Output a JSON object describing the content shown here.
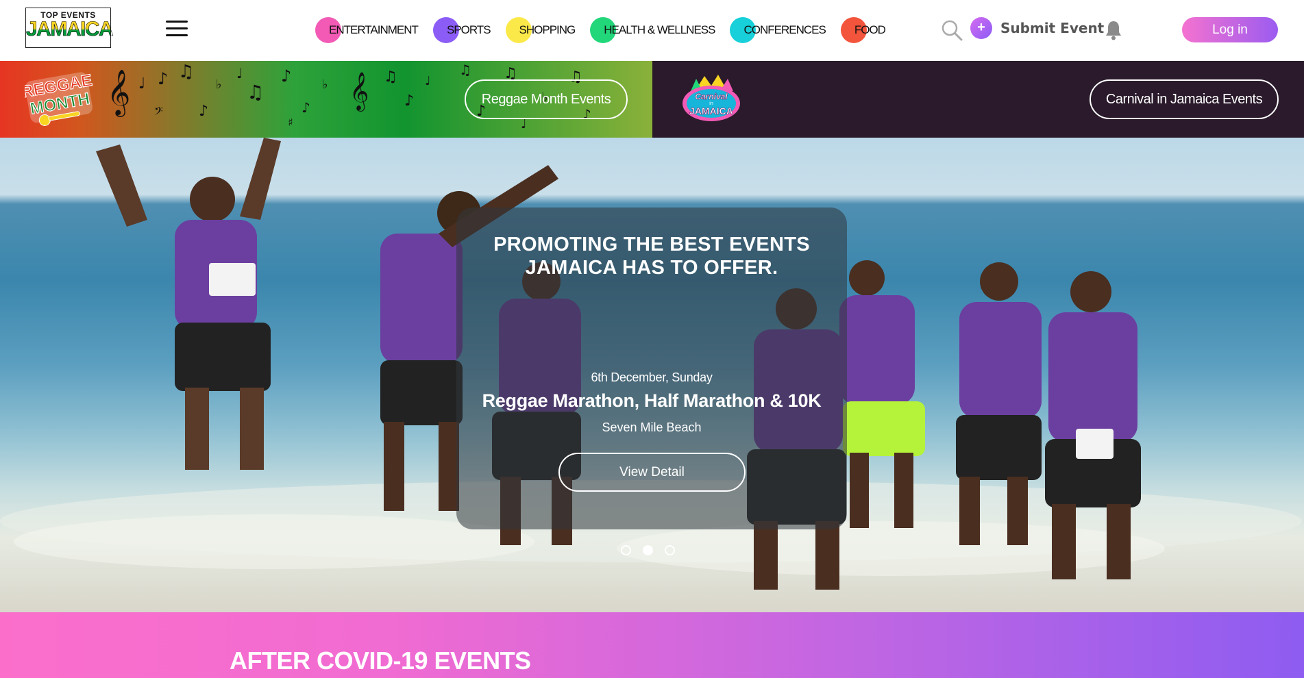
{
  "brand": {
    "logo_line1": "TOP EVENTS",
    "logo_line2": "JAMAICA"
  },
  "nav": {
    "categories": [
      {
        "label": "ENTERTAINMENT",
        "color": "#f25ab5"
      },
      {
        "label": "SPORTS",
        "color": "#8b5cf6"
      },
      {
        "label": "SHOPPING",
        "color": "#fbe94a"
      },
      {
        "label": "HEALTH & WELLNESS",
        "color": "#22d67a"
      },
      {
        "label": "CONFERENCES",
        "color": "#17d0d9"
      },
      {
        "label": "FOOD",
        "color": "#f3543c"
      }
    ],
    "submit_label": "Submit Event",
    "submit_plus": "+",
    "login_label": "Log in"
  },
  "banners": {
    "reggae_month_logo": "REGGAE MONTH",
    "reggae_month_button": "Reggae Month Events",
    "carnival_logo": "Carnival in Jamaica",
    "carnival_button": "Carnival in Jamaica Events"
  },
  "hero": {
    "title_line1": "PROMOTING THE BEST EVENTS",
    "title_line2": "JAMAICA HAS TO OFFER.",
    "date": "6th December, Sunday",
    "event_name": "Reggae Marathon, Half Marathon & 10K",
    "location": "Seven Mile Beach",
    "button_label": "View Detail",
    "slides": 3,
    "active_slide": 2
  },
  "sections": {
    "covid_title": "AFTER COVID-19 EVENTS"
  },
  "colors": {
    "login_gradient_start": "#f472d0",
    "login_gradient_end": "#9b5cf0",
    "carnival_bg": "#2a1a2b",
    "covid_gradient_start": "#fb6fcb",
    "covid_gradient_end": "#8e5cf1"
  }
}
